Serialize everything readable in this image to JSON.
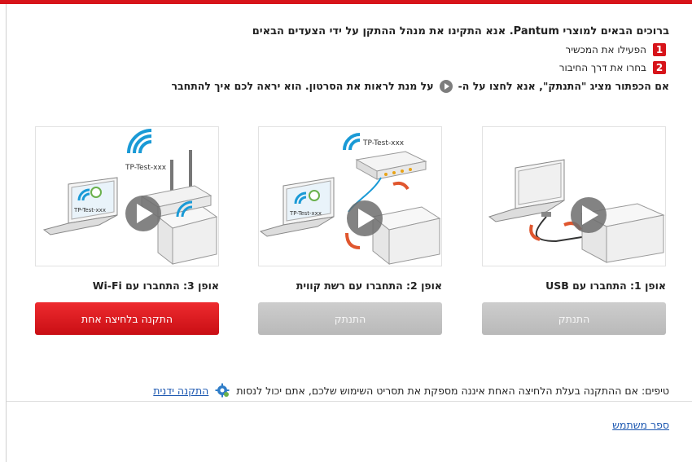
{
  "intro": {
    "title": "ברוכים הבאים למוצרי Pantum. אנא התקינו את מנהל ההתקן על ידי הצעדים הבאים",
    "steps": [
      {
        "num": "1",
        "text": "הפעילו את המכשיר"
      },
      {
        "num": "2",
        "text": "בחרו את דרך החיבור"
      }
    ],
    "note_before": "אם הכפתור מציג \"התנתק\", אנא לחצו על ה-",
    "note_after": "על מנת לראות את הסרטון. הוא יראה לכם איך להתחבר"
  },
  "options": [
    {
      "label": "אופן 1: התחברו עם USB",
      "button": "התנתק",
      "state": "disabled"
    },
    {
      "label": "אופן 2: התחברו עם רשת קווית",
      "button": "התנתק",
      "state": "disabled"
    },
    {
      "label": "אופן 3: התחברו עם Wi-Fi",
      "button": "התקנה בלחיצה אחת",
      "state": "active"
    }
  ],
  "illustration": {
    "ssid": "TP-Test-xxx"
  },
  "tips": {
    "text": "טיפים: אם ההתקנה בעלת הלחיצה האחת איננה מספקת את תסריט השימוש שלכם, אתם יכול לנסות",
    "link": "התקנה ידנית"
  },
  "manual_link": "ספר משתמש",
  "colors": {
    "accent": "#d7141a",
    "link": "#1a56b0",
    "disabled": "#c4c4c4"
  }
}
